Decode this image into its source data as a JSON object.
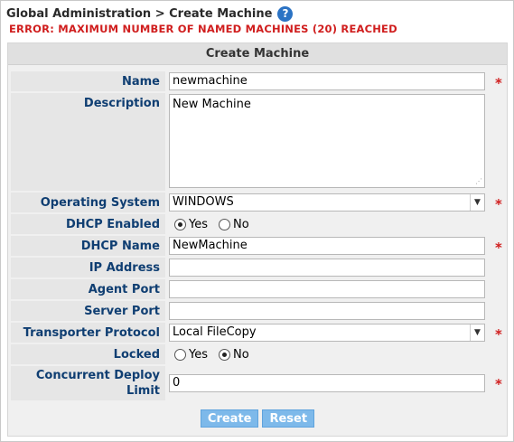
{
  "breadcrumb": "Global Administration > Create Machine",
  "help_icon": "?",
  "error": "ERROR: MAXIMUM NUMBER OF NAMED MACHINES (20) REACHED",
  "panel_title": "Create Machine",
  "required_marker": "*",
  "fields": {
    "name": {
      "label": "Name",
      "value": "newmachine"
    },
    "description": {
      "label": "Description",
      "value": "New Machine"
    },
    "os": {
      "label": "Operating System",
      "value": "WINDOWS"
    },
    "dhcp_enabled": {
      "label": "DHCP Enabled",
      "yes": "Yes",
      "no": "No"
    },
    "dhcp_name": {
      "label": "DHCP Name",
      "value": "NewMachine"
    },
    "ip": {
      "label": "IP Address",
      "value": ""
    },
    "agent_port": {
      "label": "Agent Port",
      "value": ""
    },
    "server_port": {
      "label": "Server Port",
      "value": ""
    },
    "transporter": {
      "label": "Transporter Protocol",
      "value": "Local FileCopy"
    },
    "locked": {
      "label": "Locked",
      "yes": "Yes",
      "no": "No"
    },
    "deploy_limit": {
      "label_line1": "Concurrent Deploy",
      "label_line2": "Limit",
      "value": "0"
    }
  },
  "buttons": {
    "create": "Create",
    "reset": "Reset"
  },
  "state": {
    "dhcp_enabled": "Yes",
    "locked": "No"
  },
  "colors": {
    "label_text": "#0f3e72",
    "error": "#d01e1e",
    "button": "#7db9ea"
  }
}
